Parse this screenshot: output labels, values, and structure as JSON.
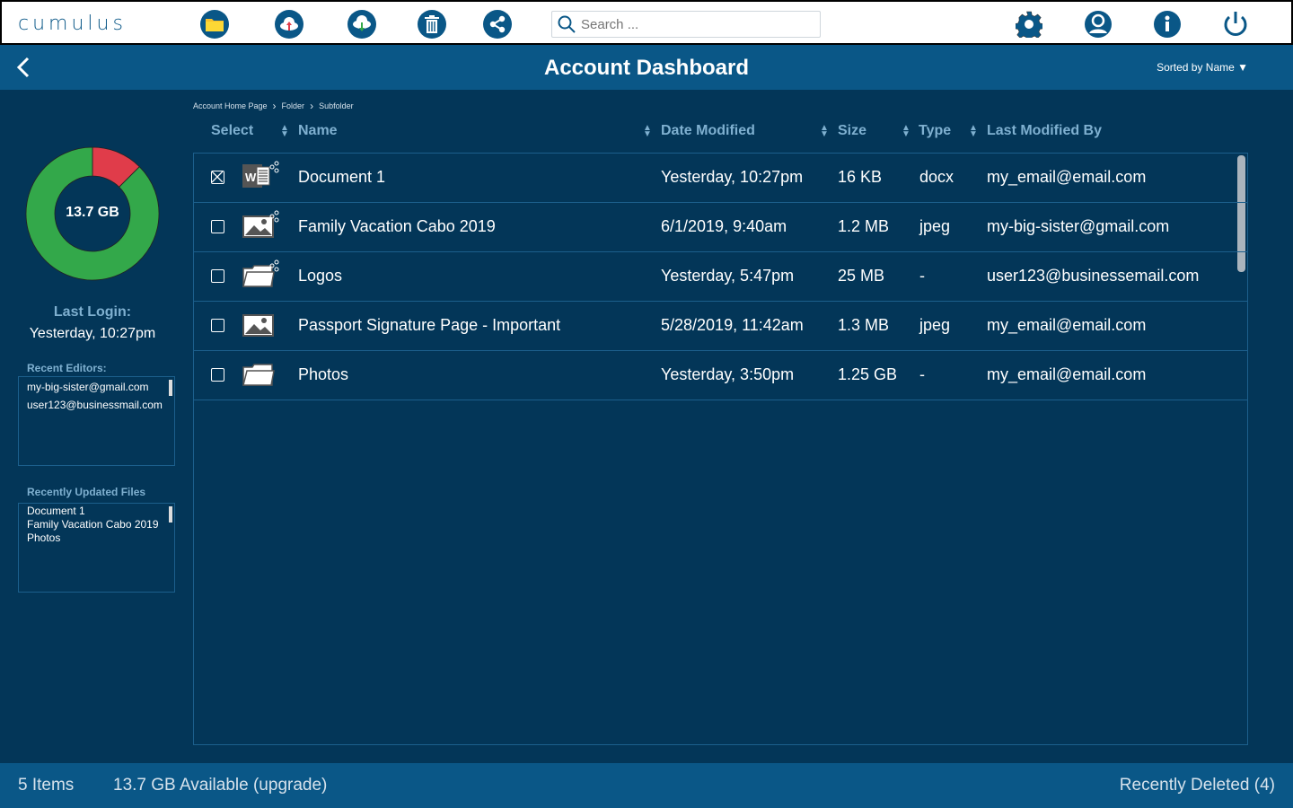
{
  "app": {
    "logo": "cumulus"
  },
  "toolbar": {
    "icons": [
      "folder-icon",
      "cloud-upload-icon",
      "cloud-download-icon",
      "trash-icon",
      "share-icon"
    ],
    "search_placeholder": "Search ...",
    "right_icons": [
      "gear-icon",
      "user-icon",
      "info-icon",
      "power-icon"
    ]
  },
  "header": {
    "title": "Account Dashboard",
    "sorted": "Sorted by Name ▼"
  },
  "breadcrumb": [
    "Account Home Page",
    "Folder",
    "Subfolder"
  ],
  "columns": {
    "select": "Select",
    "name": "Name",
    "date": "Date Modified",
    "size": "Size",
    "type": "Type",
    "by": "Last Modified By"
  },
  "rows": [
    {
      "checked": true,
      "icon": "word-doc-icon",
      "shared": true,
      "name": "Document 1",
      "date": "Yesterday, 10:27pm",
      "size": "16 KB",
      "type": "docx",
      "by": "my_email@email.com"
    },
    {
      "checked": false,
      "icon": "image-icon",
      "shared": true,
      "name": "Family Vacation Cabo 2019",
      "date": "6/1/2019, 9:40am",
      "size": "1.2 MB",
      "type": "jpeg",
      "by": "my-big-sister@gmail.com"
    },
    {
      "checked": false,
      "icon": "folder-icon",
      "shared": true,
      "name": "Logos",
      "date": "Yesterday, 5:47pm",
      "size": "25 MB",
      "type": "-",
      "by": "user123@businessemail.com"
    },
    {
      "checked": false,
      "icon": "image-icon",
      "shared": false,
      "name": "Passport Signature Page - Important",
      "date": "5/28/2019, 11:42am",
      "size": "1.3 MB",
      "type": "jpeg",
      "by": "my_email@email.com"
    },
    {
      "checked": false,
      "icon": "folder-icon",
      "shared": false,
      "name": "Photos",
      "date": "Yesterday, 3:50pm",
      "size": "1.25 GB",
      "type": "-",
      "by": "my_email@email.com"
    }
  ],
  "sidebar": {
    "storage": {
      "label": "13.7 GB",
      "used_fraction": 0.125,
      "used_color": "#e03c4a",
      "free_color": "#33a84a"
    },
    "last_login_label": "Last Login:",
    "last_login": "Yesterday, 10:27pm",
    "recent_editors_label": "Recent Editors:",
    "recent_editors": [
      "my-big-sister@gmail.com",
      "user123@businessmail.com"
    ],
    "recent_files_label": "Recently Updated Files",
    "recent_files": [
      "Document 1",
      "Family Vacation Cabo 2019",
      "Photos"
    ]
  },
  "footer": {
    "items": "5 Items",
    "available": "13.7 GB Available (upgrade)",
    "deleted": "Recently Deleted (4)"
  }
}
